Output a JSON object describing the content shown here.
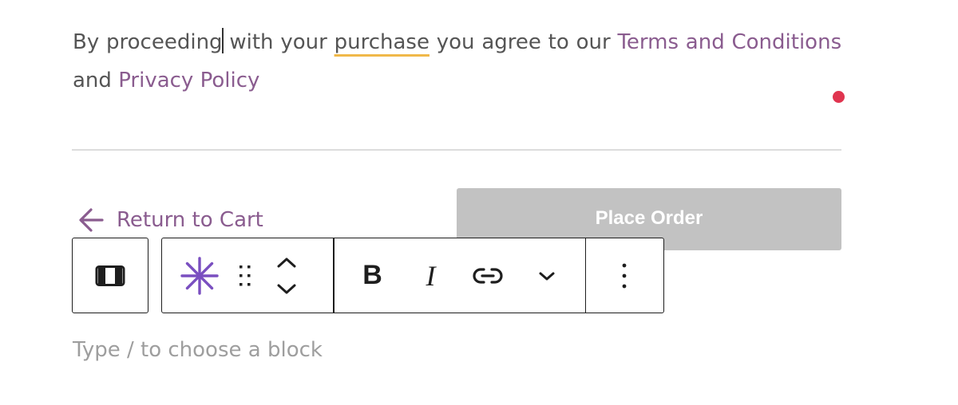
{
  "terms": {
    "words": [
      "By",
      "proceeding",
      "with",
      "your",
      "purchase",
      "you",
      "agree",
      "to",
      "our"
    ],
    "terms_link": "Terms and Conditions",
    "and": "and",
    "privacy_link": "Privacy Policy"
  },
  "actions": {
    "return_label": "Return to Cart",
    "place_order_label": "Place Order"
  },
  "toolbar": {
    "icons": [
      "columns-block-icon",
      "sparkle-icon",
      "drag-handle-icon",
      "move-up-icon",
      "move-down-icon",
      "bold-icon",
      "italic-icon",
      "link-icon",
      "chevron-down-icon",
      "more-options-icon"
    ],
    "bold_label": "B",
    "italic_label": "I"
  },
  "editor": {
    "placeholder": "Type / to choose a block"
  },
  "colors": {
    "link": "#8a5c8f",
    "sparkle": "#7a4fc0",
    "button_disabled": "#c2c2c2",
    "spell_underline": "#f0b849",
    "notice_dot": "#e0344f"
  }
}
